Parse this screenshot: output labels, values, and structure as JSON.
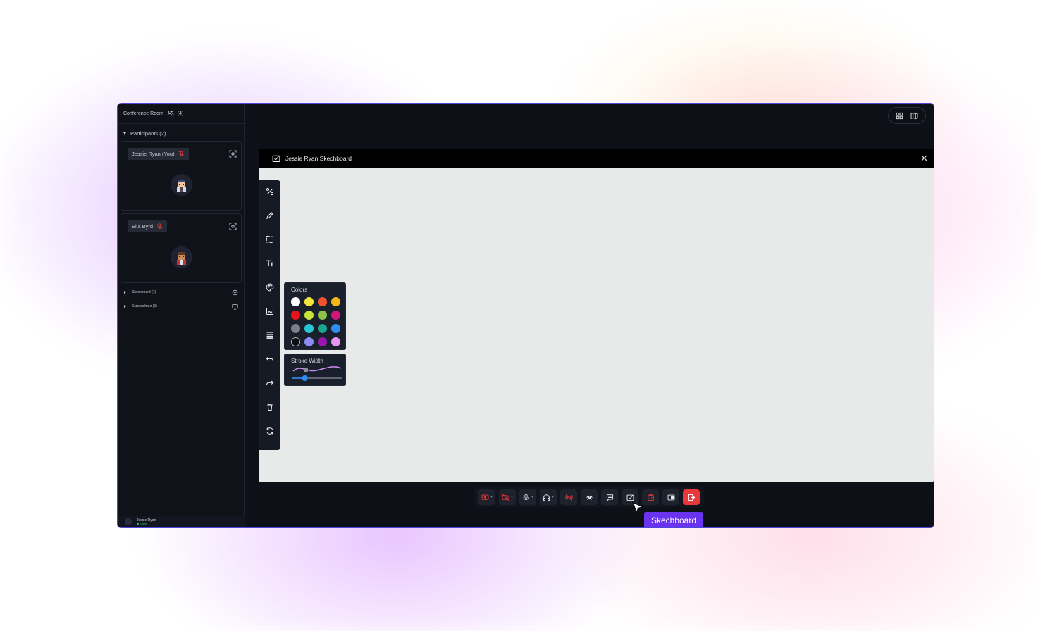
{
  "sidebar": {
    "room_title": "Conference Room",
    "room_count": "(4)",
    "participants_label": "Participants (2)",
    "participants": [
      {
        "name": "Jessie Ryan (You)",
        "mic_icon": "mic-off-icon",
        "focus_icon": "focus-icon"
      },
      {
        "name": "Ella Byrd",
        "mic_icon": "mic-off-icon",
        "focus_icon": "focus-icon"
      }
    ],
    "sketchboard_label": "Skechboard (1)",
    "screenshare_label": "Screenshare (0)",
    "footer": {
      "name": "Jessie Ryan",
      "status": "Online"
    }
  },
  "view_toggle": {
    "icons": [
      "grid-view-icon",
      "map-view-icon"
    ]
  },
  "sketch_window": {
    "title": "Jessie Ryan Skechboard",
    "icon": "sketchboard-icon",
    "controls": [
      "minimize-icon",
      "close-icon"
    ]
  },
  "toolbar": {
    "tools": [
      "shapes-tool-icon",
      "pencil-tool-icon",
      "select-tool-icon",
      "text-tool-icon",
      "palette-tool-icon",
      "image-tool-icon",
      "line-weight-tool-icon",
      "undo-icon",
      "redo-icon",
      "delete-icon",
      "refresh-icon"
    ]
  },
  "colors_popup": {
    "title": "Colors",
    "swatches": [
      "#ffffff",
      "#f5e43a",
      "#f0522d",
      "#f7b614",
      "#e8141b",
      "#c6e33a",
      "#8bc34a",
      "#d6157a",
      "#7c7f86",
      "#25c7d3",
      "#17a88f",
      "#2f8df2",
      "#0d0f14",
      "#8d8cf6",
      "#9b16b0",
      "#e695f3"
    ]
  },
  "stroke_popup": {
    "title": "Stroke Width",
    "value": 0.25
  },
  "dock": {
    "buttons": [
      "screen-record-icon",
      "camera-off-icon",
      "microphone-icon",
      "headphones-icon",
      "no-broadcast-icon",
      "broadcast-icon",
      "chat-icon",
      "sketchboard-icon",
      "whiteboard-icon",
      "picture-in-picture-icon",
      "leave-call-icon"
    ],
    "tooltip": "Skechboard"
  },
  "colors": {
    "accent": "#6a33f0",
    "danger": "#e8383b",
    "border": "#4e46d8"
  }
}
